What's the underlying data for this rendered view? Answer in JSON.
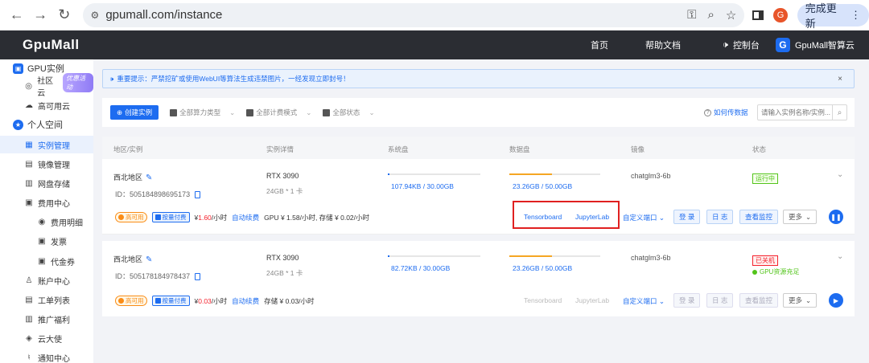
{
  "browser": {
    "url": "gpumall.com/instance",
    "update_label": "完成更新",
    "profile_initial": "G",
    "icons": [
      "back-icon",
      "forward-icon",
      "reload-icon",
      "site-info-icon",
      "key-icon",
      "zoom-icon",
      "star-icon",
      "sidepanel-icon",
      "menu-icon"
    ]
  },
  "topnav": {
    "logo": "GpuMall",
    "links": [
      "首页",
      "帮助文档"
    ],
    "console": "控制台",
    "account_initial": "G",
    "account": "GpuMall智算云"
  },
  "sidebar": {
    "items": [
      {
        "label": "GPU实例",
        "icon": "gpu-icon"
      },
      {
        "label": "社区云",
        "icon": "community-icon",
        "badge": "优惠活动"
      },
      {
        "label": "高可用云",
        "icon": "cloud-icon"
      },
      {
        "label": "个人空间",
        "icon": "person-icon"
      },
      {
        "label": "实例管理",
        "icon": "grid-icon"
      },
      {
        "label": "镜像管理",
        "icon": "image-icon"
      },
      {
        "label": "网盘存储",
        "icon": "storage-icon"
      },
      {
        "label": "费用中心",
        "icon": "fee-icon"
      },
      {
        "label": "费用明细",
        "icon": "fee-detail-icon"
      },
      {
        "label": "发票",
        "icon": "invoice-icon"
      },
      {
        "label": "代金券",
        "icon": "voucher-icon"
      },
      {
        "label": "账户中心",
        "icon": "account-icon"
      },
      {
        "label": "工单列表",
        "icon": "ticket-icon"
      },
      {
        "label": "推广福利",
        "icon": "gift-icon"
      },
      {
        "label": "云大使",
        "icon": "ambassador-icon"
      },
      {
        "label": "通知中心",
        "icon": "bell-icon"
      }
    ]
  },
  "notice": {
    "text": "重要提示：严禁挖矿或使用WebUI等算法生成违禁图片，一经发现立即封号！",
    "close": "×"
  },
  "toolbar": {
    "create_label": "创建实例",
    "filters": [
      "全部算力类型",
      "全部计费模式",
      "全部状态"
    ],
    "help_label": "如何传数据",
    "search_placeholder": "请输入实例名称/实例..."
  },
  "table": {
    "headers": [
      "地区/实例",
      "实例详情",
      "系统盘",
      "数据盘",
      "镜像",
      "状态"
    ]
  },
  "instances": [
    {
      "region": "西北地区",
      "id": "ID：505184898695173",
      "gpu": "RTX 3090",
      "spec": "24GB * 1 卡",
      "system_disk": "107.94KB / 30.00GB",
      "system_disk_fraction": 0.02,
      "data_disk": "23.26GB / 50.00GB",
      "data_disk_fraction": 0.47,
      "image": "chatglm3-6b",
      "status": "运行中",
      "status_extra": "",
      "tag_ha": "高可用",
      "tag_billing": "按量付费",
      "price_prefix": "¥",
      "price_value": "1.60",
      "price_suffix": "/小时",
      "auto_renew": "自动续费",
      "detail": "GPU ¥ 1.58/小时, 存储 ¥ 0.02/小时",
      "actions": {
        "tensorboard": "Tensorboard",
        "jupyterlab": "JupyterLab",
        "custom_port": "自定义端口",
        "login": "登 录",
        "log": "日 志",
        "monitor": "查看监控",
        "more": "更多"
      }
    },
    {
      "region": "西北地区",
      "id": "ID：505178184978437",
      "gpu": "RTX 3090",
      "spec": "24GB * 1 卡",
      "system_disk": "82.72KB / 30.00GB",
      "system_disk_fraction": 0.02,
      "data_disk": "23.26GB / 50.00GB",
      "data_disk_fraction": 0.47,
      "image": "chatglm3-6b",
      "status": "已关机",
      "status_extra": "GPU资源充足",
      "tag_ha": "高可用",
      "tag_billing": "按量付费",
      "price_prefix": "¥",
      "price_value": "0.03",
      "price_suffix": "/小时",
      "auto_renew": "自动续费",
      "detail": "存储 ¥ 0.03/小时",
      "actions": {
        "tensorboard": "Tensorboard",
        "jupyterlab": "JupyterLab",
        "custom_port": "自定义端口",
        "login": "登 录",
        "log": "日 志",
        "monitor": "查看监控",
        "more": "更多"
      }
    }
  ],
  "colors": {
    "accent": "#1d6cf0",
    "nav_bg": "#2b2d33",
    "running": "#52c41a",
    "stopped": "#f5222d",
    "data_bar": "#f5a623",
    "highlight": "#e02020"
  }
}
